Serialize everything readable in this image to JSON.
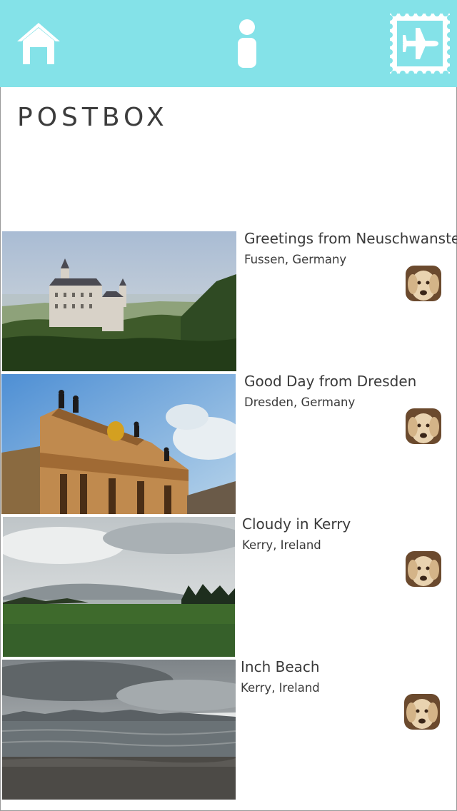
{
  "nav": {
    "home_icon": "home-icon",
    "info_icon": "info-icon",
    "stamp_icon": "airmail-stamp-icon",
    "bar_color": "#84e2e8"
  },
  "page": {
    "title": "POSTBOX"
  },
  "postcards": [
    {
      "title": "Greetings from Neuschwanstein",
      "location": "Fussen, Germany",
      "photo": "castle-photo",
      "sender_avatar": "dog-avatar"
    },
    {
      "title": "Good Day from Dresden",
      "location": "Dresden, Germany",
      "photo": "palace-photo",
      "sender_avatar": "dog-avatar"
    },
    {
      "title": "Cloudy in Kerry",
      "location": "Kerry, Ireland",
      "photo": "field-photo",
      "sender_avatar": "dog-avatar"
    },
    {
      "title": "Inch Beach",
      "location": "Kerry, Ireland",
      "photo": "beach-photo",
      "sender_avatar": "dog-avatar"
    }
  ]
}
